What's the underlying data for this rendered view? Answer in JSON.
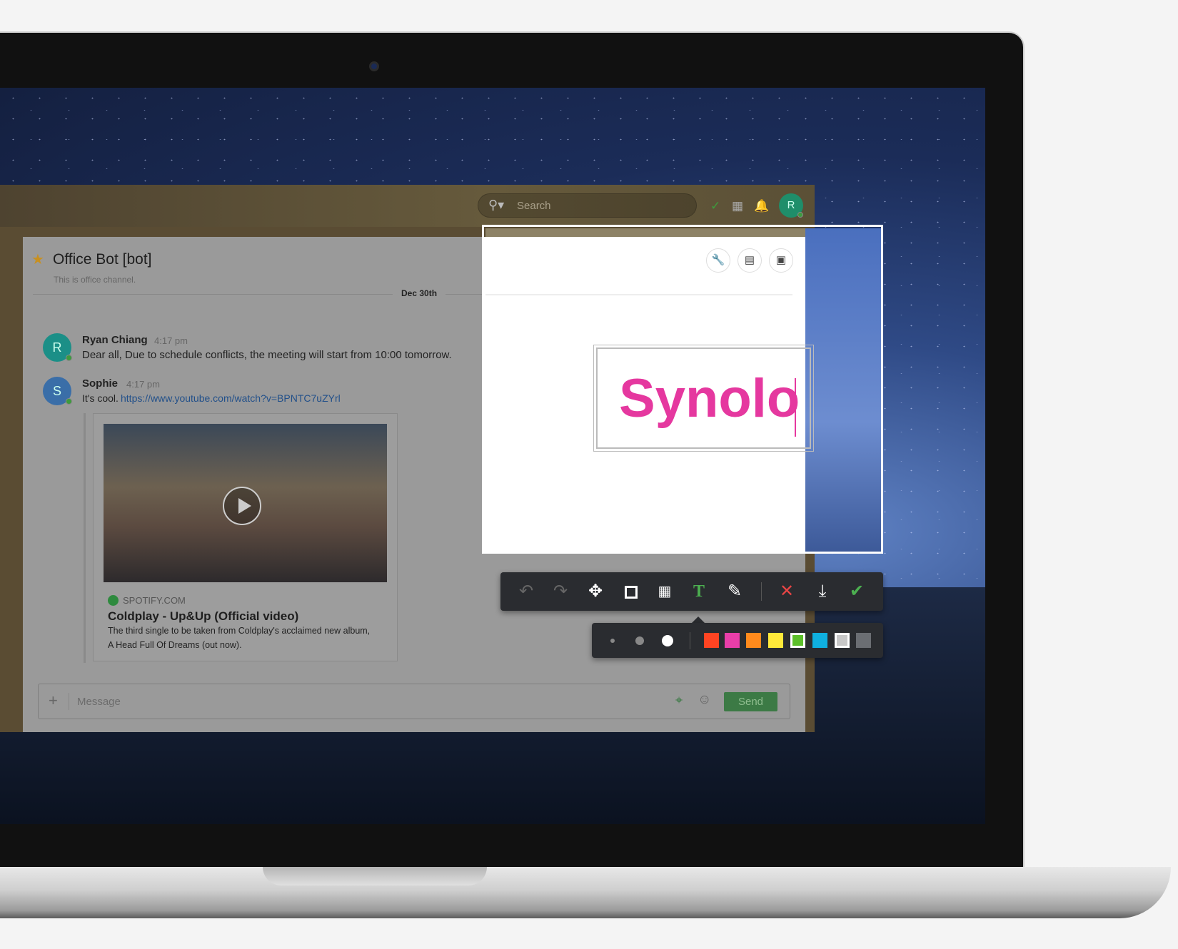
{
  "header": {
    "search_placeholder": "Search",
    "avatar_initial": "R"
  },
  "channel": {
    "title": "Office Bot [bot]",
    "subtitle": "This is office channel.",
    "date_divider": "Dec 30th"
  },
  "messages": [
    {
      "author": "Ryan Chiang",
      "initial": "R",
      "time": "4:17 pm",
      "text": "Dear all, Due to schedule conflicts, the meeting will start from 10:00 tomorrow.",
      "avatar_color": "#1b8f87"
    },
    {
      "author": "Sophie",
      "initial": "S",
      "time": "4:17 pm",
      "text": "It's cool.",
      "link": "https://www.youtube.com/watch?v=BPNTC7uZYrl",
      "avatar_color": "#3a6ea8"
    }
  ],
  "embed": {
    "source": "SPOTIFY.COM",
    "title": "Coldplay - Up&Up (Official video)",
    "description_line1": "The third single to be taken from Coldplay's acclaimed new album,",
    "description_line2": "A Head Full Of Dreams (out now)."
  },
  "composer": {
    "placeholder": "Message",
    "send_label": "Send"
  },
  "annotation": {
    "text": "Synolo",
    "text_color": "#e5389f"
  },
  "toolbar": {
    "tools": [
      "undo",
      "redo",
      "move",
      "rectangle",
      "mosaic",
      "text",
      "pencil",
      "cancel",
      "download",
      "confirm"
    ],
    "active_tool": "text"
  },
  "palette": {
    "sizes": [
      "small",
      "medium",
      "large"
    ],
    "selected_size": "large",
    "colors": [
      "#ff4422",
      "#e93ea9",
      "#ff8a1c",
      "#ffe93a",
      "#5cbf2a",
      "#0fb0e0",
      "#c8c8c8",
      "#6b6e73"
    ],
    "selected_color": "#5cbf2a"
  }
}
